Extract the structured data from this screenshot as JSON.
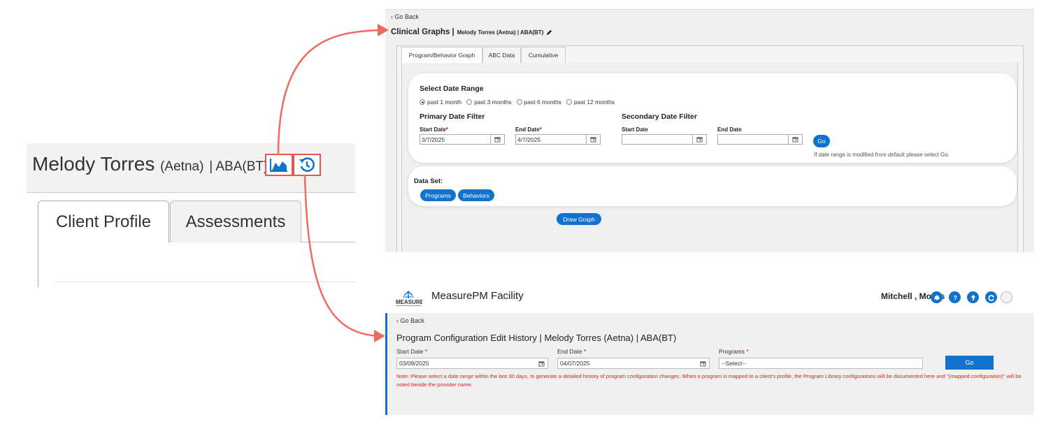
{
  "left_panel": {
    "client_name": "Melody Torres",
    "payer": "(Aetna)",
    "program_tag": "| ABA(BT)",
    "tabs": [
      {
        "label": "Client Profile"
      },
      {
        "label": "Assessments"
      }
    ],
    "icons": [
      "clinical-graph-icon",
      "edit-history-icon"
    ]
  },
  "clinical_graphs": {
    "back_label": "‹ Go Back",
    "title": "Clinical Graphs |",
    "subtitle": "Melody Torres (Aetna) | ABA(BT)",
    "tabs": [
      {
        "label": "Program/Behavior Graph"
      },
      {
        "label": "ABC Data"
      },
      {
        "label": "Cumulative"
      }
    ],
    "date_range": {
      "heading": "Select Date Range",
      "options": [
        {
          "label": "past 1 month",
          "selected": true
        },
        {
          "label": "past 3 months",
          "selected": false
        },
        {
          "label": "past 6 months",
          "selected": false
        },
        {
          "label": "past 12 months",
          "selected": false
        }
      ]
    },
    "primary_filter": {
      "heading": "Primary Date Filter",
      "start_label": "Start Date",
      "start_value": "3/7/2025",
      "end_label": "End Date",
      "end_value": "4/7/2025"
    },
    "secondary_filter": {
      "heading": "Secondary Date Filter",
      "start_label": "Start Date",
      "start_value": "",
      "end_label": "End Date",
      "end_value": ""
    },
    "go_label": "Go",
    "go_note": "If date range is modified from default please select Go.",
    "data_set": {
      "heading": "Data Set:",
      "items": [
        {
          "label": "Programs"
        },
        {
          "label": "Behaviors"
        }
      ]
    },
    "draw_graph_label": "Draw Graph"
  },
  "program_config": {
    "logo_text": "MEASURE",
    "facility": "MeasurePM Facility",
    "user": "Mitchell , Morris",
    "back_label": "‹ Go Back",
    "title": "Program Configuration Edit History | Melody Torres (Aetna) | ABA(BT)",
    "start_label": "Start Date",
    "start_value": "03/09/2025",
    "end_label": "End Date",
    "end_value": "04/07/2025",
    "programs_label": "Programs",
    "programs_value": "--Select--",
    "go_label": "Go",
    "note": "Note: Please select a date range within the last 30 days, to generate a detailed history of program configuration changes. When a program is mapped to a client's profile, the Program Library configurations will be documented here and \"(mapped configuration)\" will be noted beside the provider name."
  },
  "colors": {
    "accent": "#1273cf",
    "highlight": "#e8554e",
    "note_red": "#e02020"
  }
}
